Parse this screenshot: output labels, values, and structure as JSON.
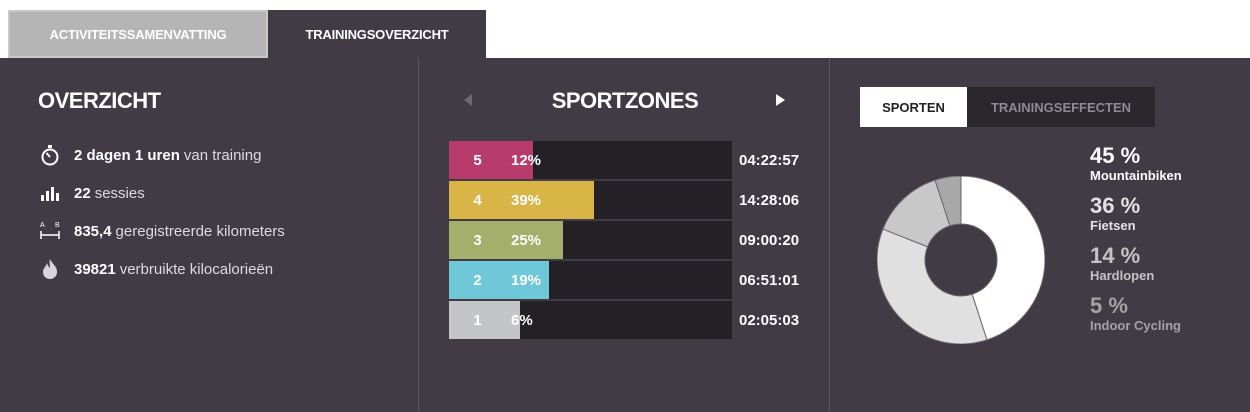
{
  "tabs": {
    "activity_summary": "ACTIVITEITSSAMENVATTING",
    "training_overview": "TRAININGSOVERZICHT"
  },
  "overview": {
    "title": "OVERZICHT",
    "rows": [
      {
        "icon": "stopwatch-icon",
        "bold1": "2 dagen 1 uren",
        "text": "van training"
      },
      {
        "icon": "bar-chart-icon",
        "bold1": "22",
        "text": "sessies"
      },
      {
        "icon": "distance-icon",
        "bold1": "835,4",
        "text": "geregistreerde kilometers"
      },
      {
        "icon": "flame-icon",
        "bold1": "39821",
        "text": "verbruikte kilocalorieën"
      }
    ]
  },
  "sportzones": {
    "title": "SPORTZONES",
    "zones": [
      {
        "zone": "5",
        "percent": "12%",
        "fraction": 0.12,
        "time": "04:22:57",
        "color": "#b83c6b"
      },
      {
        "zone": "4",
        "percent": "39%",
        "fraction": 0.39,
        "time": "14:28:06",
        "color": "#d9b547"
      },
      {
        "zone": "3",
        "percent": "25%",
        "fraction": 0.25,
        "time": "09:00:20",
        "color": "#a4af6b"
      },
      {
        "zone": "2",
        "percent": "19%",
        "fraction": 0.19,
        "time": "06:51:01",
        "color": "#6ec8d8"
      },
      {
        "zone": "1",
        "percent": "6%",
        "fraction": 0.06,
        "time": "02:05:03",
        "color": "#c3c5c6"
      }
    ]
  },
  "sports": {
    "tab_sports": "SPORTEN",
    "tab_effects": "TRAININGSEFFECTEN",
    "items": [
      {
        "percent": "45 %",
        "value": 45,
        "label": "Mountainbiken",
        "color": "#ffffff"
      },
      {
        "percent": "36 %",
        "value": 36,
        "label": "Fietsen",
        "color": "#e0e0e0"
      },
      {
        "percent": "14 %",
        "value": 14,
        "label": "Hardlopen",
        "color": "#c8c8c8"
      },
      {
        "percent": "5 %",
        "value": 5,
        "label": "Indoor Cycling",
        "color": "#a8a8a8"
      }
    ]
  }
}
